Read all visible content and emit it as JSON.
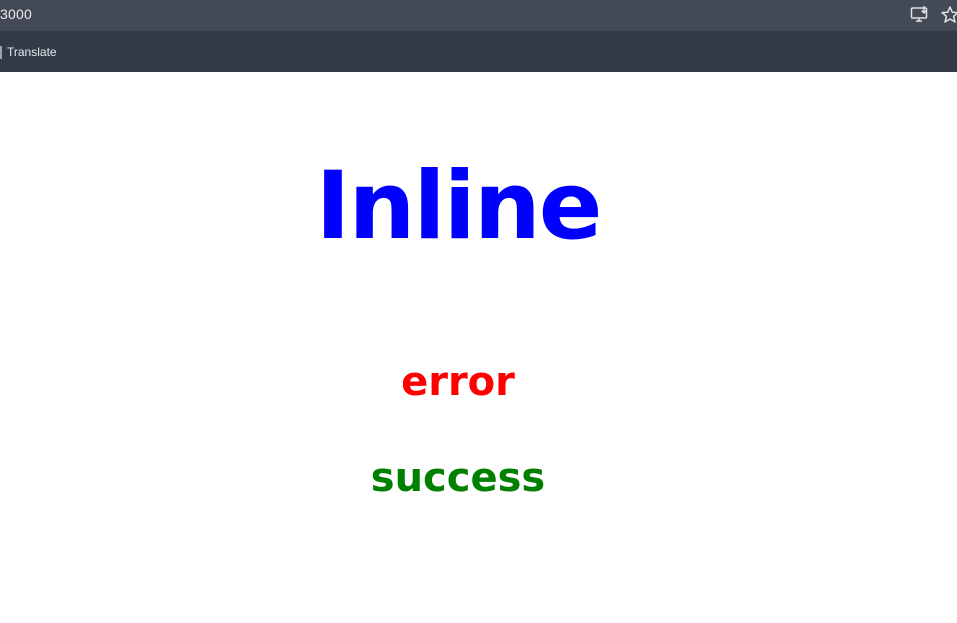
{
  "browser": {
    "url": "3000",
    "bookmarks": [
      {
        "label": "Translate"
      }
    ],
    "icons": {
      "install": "install-app-icon",
      "bookmark": "star-icon"
    }
  },
  "content": {
    "heading": "Inline",
    "error_text": "error",
    "success_text": "success"
  },
  "colors": {
    "heading": "#0000ff",
    "error": "#ff0000",
    "success": "#008000",
    "address_bar": "#434a55",
    "bookmarks_bar": "#323a48"
  }
}
